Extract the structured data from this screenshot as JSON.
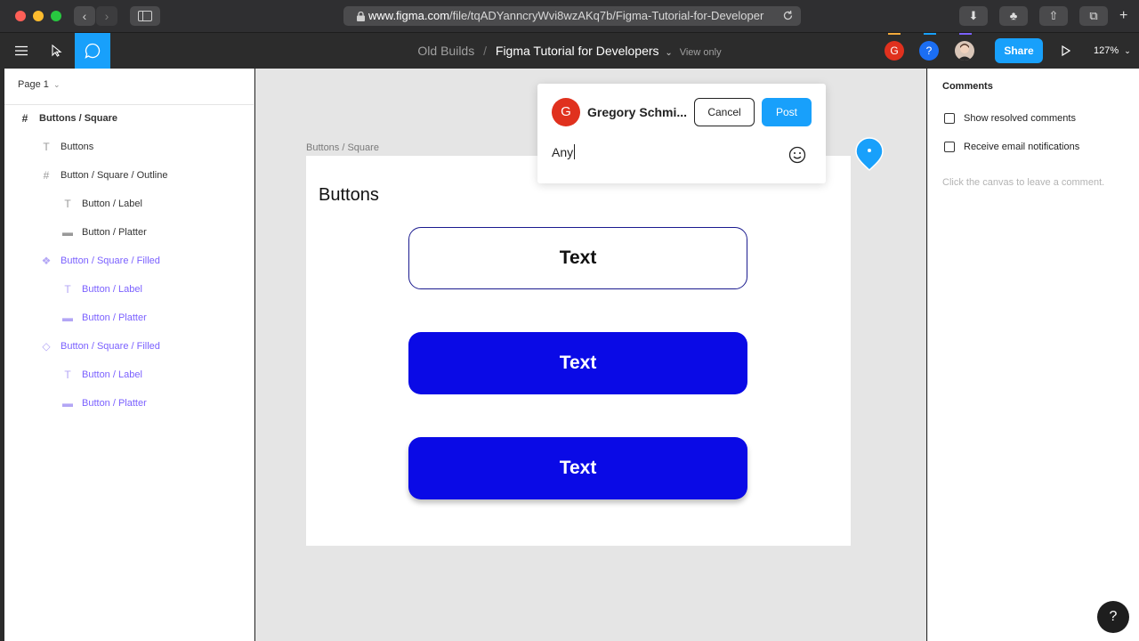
{
  "browser": {
    "url_host": "www.figma.com",
    "url_path": "/file/tqADYanncryWvi8wzAKq7b/Figma-Tutorial-for-Developer"
  },
  "toolbar": {
    "breadcrumb_parent": "Old Builds",
    "breadcrumb_separator": "/",
    "file_name": "Figma Tutorial for Developers",
    "view_mode": "View only",
    "avatar_user_initial": "G",
    "avatar_help_label": "?",
    "share_label": "Share",
    "zoom": "127%"
  },
  "layers": {
    "page": "Page 1",
    "items": [
      {
        "label": "Buttons / Square",
        "icon": "frame-icon"
      },
      {
        "label": "Buttons",
        "icon": "text-icon"
      },
      {
        "label": "Button / Square / Outline",
        "icon": "frame-icon"
      },
      {
        "label": "Button / Label",
        "icon": "text-icon"
      },
      {
        "label": "Button / Platter",
        "icon": "rectangle-icon"
      },
      {
        "label": "Button / Square / Filled",
        "icon": "component-icon"
      },
      {
        "label": "Button / Label",
        "icon": "text-icon"
      },
      {
        "label": "Button / Platter",
        "icon": "rectangle-icon"
      },
      {
        "label": "Button / Square / Filled",
        "icon": "instance-icon"
      },
      {
        "label": "Button / Label",
        "icon": "text-icon"
      },
      {
        "label": "Button / Platter",
        "icon": "rectangle-icon"
      }
    ]
  },
  "canvas": {
    "frame_title": "Buttons / Square",
    "heading": "Buttons",
    "buttons": [
      "Text",
      "Text",
      "Text"
    ],
    "colors": {
      "filled": "#0a0ae6",
      "outline": "#1b1b8f",
      "accent": "#18a0fb"
    }
  },
  "comment": {
    "avatar_initial": "G",
    "author": "Gregory Schmi...",
    "cancel_label": "Cancel",
    "post_label": "Post",
    "input_value": "Any"
  },
  "right_panel": {
    "title": "Comments",
    "show_resolved": "Show resolved comments",
    "email_notifications": "Receive email notifications",
    "hint": "Click the canvas to leave a comment."
  },
  "help_label": "?"
}
